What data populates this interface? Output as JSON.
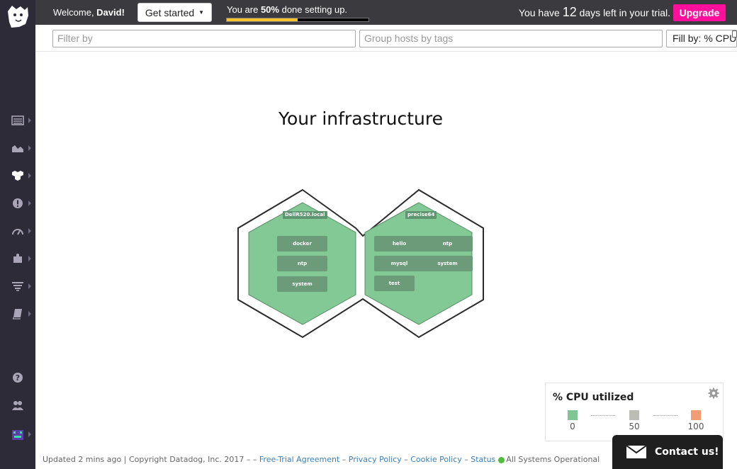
{
  "topbar": {
    "welcome_prefix": "Welcome, ",
    "welcome_user": "David!",
    "get_started_label": "Get started",
    "setup_prefix": "You are ",
    "setup_percent_label": "50%",
    "setup_suffix": " done setting up.",
    "setup_progress": 0.5,
    "trial_prefix": "You have ",
    "trial_days": "12",
    "trial_suffix": " days left in your trial.",
    "upgrade_label": "Upgrade",
    "accent_color": "#ff0f9b",
    "progress_color": "#f6c32a"
  },
  "filterbar": {
    "filter_placeholder": "Filter by",
    "group_placeholder": "Group hosts by tags",
    "fill_by_label": "Fill by: % CPU"
  },
  "sidebar": {
    "items": [
      {
        "name": "dashboards",
        "icon": "list-icon"
      },
      {
        "name": "metrics",
        "icon": "area-chart-icon"
      },
      {
        "name": "infrastructure",
        "icon": "hexagons-icon"
      },
      {
        "name": "monitors",
        "icon": "alert-icon"
      },
      {
        "name": "apm",
        "icon": "gauge-icon"
      },
      {
        "name": "integrations",
        "icon": "puzzle-icon"
      },
      {
        "name": "logs",
        "icon": "filter-icon"
      },
      {
        "name": "notebooks",
        "icon": "book-icon"
      }
    ],
    "bottom": [
      {
        "name": "help",
        "icon": "help-icon"
      },
      {
        "name": "team",
        "icon": "users-icon"
      },
      {
        "name": "account",
        "icon": "avatar-icon"
      }
    ]
  },
  "main": {
    "title": "Your infrastructure",
    "hosts": [
      {
        "name": "DellR520.local",
        "apps": [
          "docker",
          "ntp",
          "system"
        ],
        "color": "#82c995"
      },
      {
        "name": "precise64",
        "apps": [
          "hello",
          "ntp",
          "mysql",
          "system",
          "test"
        ],
        "color": "#82c995"
      }
    ]
  },
  "legend": {
    "title": "% CPU utilized",
    "stops": [
      {
        "value": "0",
        "color": "#7fc693"
      },
      {
        "value": "50",
        "color": "#bdbdb7"
      },
      {
        "value": "100",
        "color": "#f29c76"
      }
    ]
  },
  "footer": {
    "updated": "Updated 2 mins ago",
    "sep": " | ",
    "copyright": "Copyright Datadog, Inc. 2017 – – ",
    "links": [
      "Free-Trial Agreement",
      "Privacy Policy",
      "Cookie Policy",
      "Status"
    ],
    "link_sep": " – ",
    "status": "All Systems Operational",
    "status_color": "#4fbe3a"
  },
  "contact": {
    "label": "Contact us!"
  }
}
